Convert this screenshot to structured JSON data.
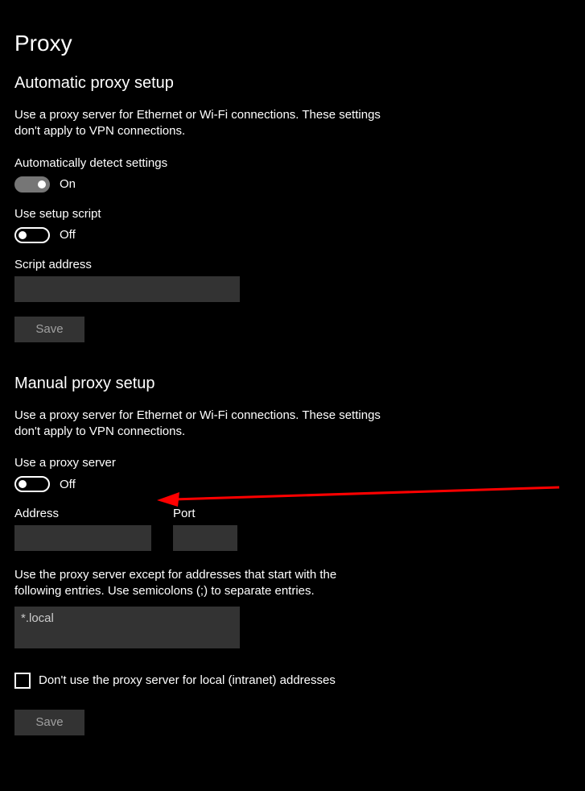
{
  "page": {
    "title": "Proxy"
  },
  "automatic": {
    "heading": "Automatic proxy setup",
    "description": "Use a proxy server for Ethernet or Wi-Fi connections. These settings don't apply to VPN connections.",
    "autodetect": {
      "label": "Automatically detect settings",
      "state": "On",
      "on": true
    },
    "setupscript": {
      "label": "Use setup script",
      "state": "Off",
      "on": false
    },
    "script_address": {
      "label": "Script address",
      "value": ""
    },
    "save_label": "Save"
  },
  "manual": {
    "heading": "Manual proxy setup",
    "description": "Use a proxy server for Ethernet or Wi-Fi connections. These settings don't apply to VPN connections.",
    "useproxy": {
      "label": "Use a proxy server",
      "state": "Off",
      "on": false
    },
    "address": {
      "label": "Address",
      "value": ""
    },
    "port": {
      "label": "Port",
      "value": ""
    },
    "exceptions": {
      "label": "Use the proxy server except for addresses that start with the following entries. Use semicolons (;) to separate entries.",
      "value": "*.local"
    },
    "bypass_local": {
      "label": "Don't use the proxy server for local (intranet) addresses",
      "checked": false
    },
    "save_label": "Save"
  }
}
